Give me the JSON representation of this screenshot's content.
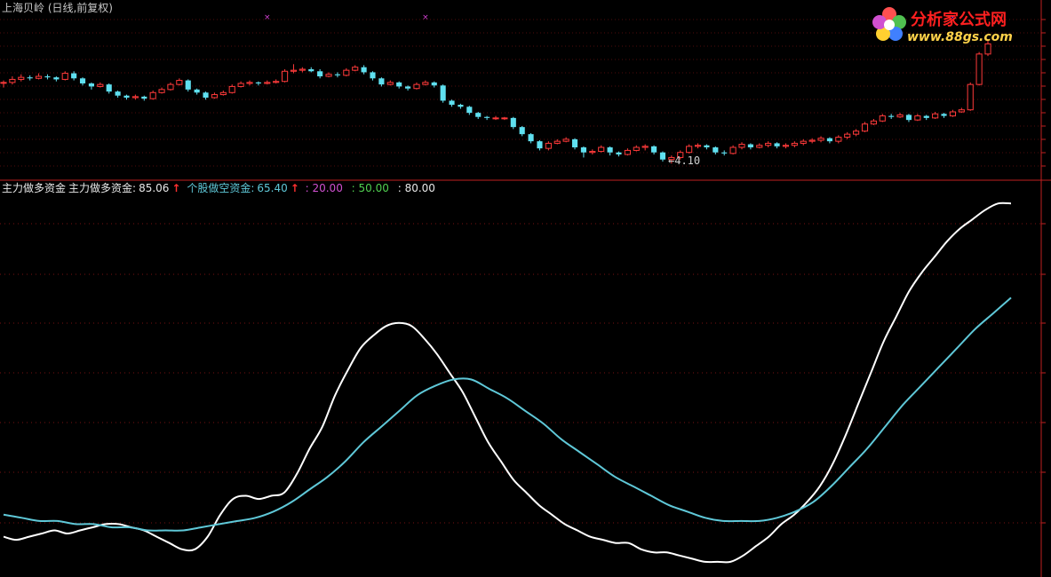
{
  "header": {
    "title": "上海贝岭 (日线,前复权)"
  },
  "logo": {
    "name": "分析家公式网",
    "url": "www.88gs.com"
  },
  "low_label": "←4.10",
  "indicator_legend": {
    "name1": "主力做多资金",
    "label_main": "主力做多资金:",
    "value_main": "85.06",
    "label_retail": "个股做空资金:",
    "value_retail": "65.40",
    "level_a": "20.00",
    "level_b": "50.00",
    "level_c": "80.00",
    "arrow": "↑"
  },
  "colors": {
    "background": "#000000",
    "up_candle": "#ff3a3a",
    "down_candle": "#5fe0f0",
    "grid": "#a01818",
    "white_line": "#ffffff",
    "cyan_line": "#5fc8d8"
  },
  "chart_data": [
    {
      "type": "candlestick",
      "ohlc": [
        [
          0.4,
          0.4,
          0.42,
          0.35
        ],
        [
          0.4,
          0.43,
          0.46,
          0.38
        ],
        [
          0.43,
          0.45,
          0.48,
          0.41
        ],
        [
          0.45,
          0.44,
          0.47,
          0.42
        ],
        [
          0.44,
          0.46,
          0.49,
          0.43
        ],
        [
          0.46,
          0.45,
          0.48,
          0.43
        ],
        [
          0.45,
          0.43,
          0.46,
          0.41
        ],
        [
          0.43,
          0.49,
          0.51,
          0.42
        ],
        [
          0.49,
          0.44,
          0.51,
          0.42
        ],
        [
          0.44,
          0.39,
          0.45,
          0.37
        ],
        [
          0.39,
          0.36,
          0.4,
          0.33
        ],
        [
          0.36,
          0.38,
          0.4,
          0.35
        ],
        [
          0.38,
          0.31,
          0.39,
          0.29
        ],
        [
          0.31,
          0.27,
          0.32,
          0.25
        ],
        [
          0.27,
          0.25,
          0.28,
          0.23
        ],
        [
          0.25,
          0.26,
          0.28,
          0.23
        ],
        [
          0.26,
          0.24,
          0.27,
          0.22
        ],
        [
          0.24,
          0.3,
          0.32,
          0.23
        ],
        [
          0.3,
          0.33,
          0.35,
          0.29
        ],
        [
          0.33,
          0.38,
          0.4,
          0.32
        ],
        [
          0.38,
          0.42,
          0.44,
          0.37
        ],
        [
          0.42,
          0.33,
          0.43,
          0.31
        ],
        [
          0.33,
          0.3,
          0.34,
          0.28
        ],
        [
          0.3,
          0.25,
          0.31,
          0.23
        ],
        [
          0.25,
          0.28,
          0.3,
          0.24
        ],
        [
          0.28,
          0.3,
          0.32,
          0.27
        ],
        [
          0.3,
          0.36,
          0.38,
          0.29
        ],
        [
          0.36,
          0.39,
          0.41,
          0.35
        ],
        [
          0.39,
          0.4,
          0.42,
          0.37
        ],
        [
          0.4,
          0.39,
          0.41,
          0.37
        ],
        [
          0.39,
          0.4,
          0.42,
          0.38
        ],
        [
          0.4,
          0.41,
          0.43,
          0.39
        ],
        [
          0.41,
          0.51,
          0.53,
          0.4
        ],
        [
          0.51,
          0.52,
          0.58,
          0.49
        ],
        [
          0.52,
          0.53,
          0.55,
          0.5
        ],
        [
          0.53,
          0.51,
          0.55,
          0.5
        ],
        [
          0.51,
          0.46,
          0.53,
          0.44
        ],
        [
          0.46,
          0.48,
          0.5,
          0.45
        ],
        [
          0.48,
          0.47,
          0.5,
          0.45
        ],
        [
          0.47,
          0.52,
          0.54,
          0.46
        ],
        [
          0.52,
          0.55,
          0.57,
          0.51
        ],
        [
          0.55,
          0.5,
          0.57,
          0.48
        ],
        [
          0.5,
          0.44,
          0.51,
          0.42
        ],
        [
          0.44,
          0.38,
          0.45,
          0.36
        ],
        [
          0.38,
          0.4,
          0.42,
          0.37
        ],
        [
          0.4,
          0.36,
          0.41,
          0.34
        ],
        [
          0.36,
          0.34,
          0.37,
          0.32
        ],
        [
          0.34,
          0.38,
          0.4,
          0.33
        ],
        [
          0.38,
          0.4,
          0.42,
          0.37
        ],
        [
          0.4,
          0.37,
          0.41,
          0.35
        ],
        [
          0.37,
          0.22,
          0.38,
          0.2
        ],
        [
          0.22,
          0.18,
          0.23,
          0.16
        ],
        [
          0.18,
          0.16,
          0.19,
          0.14
        ],
        [
          0.16,
          0.1,
          0.17,
          0.08
        ],
        [
          0.1,
          0.06,
          0.11,
          0.04
        ],
        [
          0.06,
          0.05,
          0.07,
          0.03
        ],
        [
          0.05,
          0.05,
          0.07,
          0.03
        ],
        [
          0.05,
          0.05,
          0.06,
          0.03
        ],
        [
          0.05,
          -0.04,
          0.06,
          -0.06
        ],
        [
          -0.04,
          -0.11,
          -0.03,
          -0.13
        ],
        [
          -0.11,
          -0.18,
          -0.1,
          -0.2
        ],
        [
          -0.18,
          -0.25,
          -0.17,
          -0.27
        ],
        [
          -0.25,
          -0.2,
          -0.18,
          -0.27
        ],
        [
          -0.2,
          -0.18,
          -0.16,
          -0.21
        ],
        [
          -0.18,
          -0.16,
          -0.14,
          -0.19
        ],
        [
          -0.16,
          -0.24,
          -0.15,
          -0.26
        ],
        [
          -0.24,
          -0.29,
          -0.23,
          -0.34
        ],
        [
          -0.29,
          -0.28,
          -0.26,
          -0.31
        ],
        [
          -0.28,
          -0.24,
          -0.22,
          -0.29
        ],
        [
          -0.24,
          -0.29,
          -0.23,
          -0.32
        ],
        [
          -0.29,
          -0.31,
          -0.28,
          -0.33
        ],
        [
          -0.31,
          -0.27,
          -0.25,
          -0.32
        ],
        [
          -0.27,
          -0.24,
          -0.22,
          -0.28
        ],
        [
          -0.24,
          -0.23,
          -0.21,
          -0.27
        ],
        [
          -0.23,
          -0.29,
          -0.22,
          -0.31
        ],
        [
          -0.29,
          -0.36,
          -0.28,
          -0.38
        ],
        [
          -0.36,
          -0.34,
          -0.32,
          -0.4
        ],
        [
          -0.34,
          -0.29,
          -0.27,
          -0.36
        ],
        [
          -0.29,
          -0.23,
          -0.21,
          -0.3
        ],
        [
          -0.23,
          -0.22,
          -0.2,
          -0.25
        ],
        [
          -0.22,
          -0.24,
          -0.21,
          -0.26
        ],
        [
          -0.24,
          -0.29,
          -0.23,
          -0.31
        ],
        [
          -0.29,
          -0.3,
          -0.27,
          -0.32
        ],
        [
          -0.3,
          -0.24,
          -0.22,
          -0.31
        ],
        [
          -0.24,
          -0.21,
          -0.19,
          -0.26
        ],
        [
          -0.21,
          -0.24,
          -0.2,
          -0.26
        ],
        [
          -0.24,
          -0.22,
          -0.2,
          -0.25
        ],
        [
          -0.22,
          -0.2,
          -0.18,
          -0.24
        ],
        [
          -0.2,
          -0.23,
          -0.19,
          -0.25
        ],
        [
          -0.23,
          -0.22,
          -0.2,
          -0.25
        ],
        [
          -0.22,
          -0.2,
          -0.18,
          -0.24
        ],
        [
          -0.2,
          -0.18,
          -0.16,
          -0.22
        ],
        [
          -0.18,
          -0.17,
          -0.15,
          -0.2
        ],
        [
          -0.17,
          -0.15,
          -0.13,
          -0.19
        ],
        [
          -0.15,
          -0.18,
          -0.14,
          -0.2
        ],
        [
          -0.18,
          -0.14,
          -0.12,
          -0.2
        ],
        [
          -0.14,
          -0.11,
          -0.09,
          -0.16
        ],
        [
          -0.11,
          -0.08,
          -0.06,
          -0.13
        ],
        [
          -0.08,
          -0.01,
          0.01,
          -0.09
        ],
        [
          -0.01,
          0.02,
          0.04,
          -0.02
        ],
        [
          0.02,
          0.07,
          0.09,
          0.01
        ],
        [
          0.07,
          0.06,
          0.09,
          0.04
        ],
        [
          0.06,
          0.08,
          0.1,
          0.05
        ],
        [
          0.08,
          0.03,
          0.09,
          0.01
        ],
        [
          0.03,
          0.07,
          0.09,
          0.02
        ],
        [
          0.07,
          0.05,
          0.08,
          0.03
        ],
        [
          0.05,
          0.09,
          0.11,
          0.04
        ],
        [
          0.09,
          0.07,
          0.1,
          0.05
        ],
        [
          0.07,
          0.11,
          0.13,
          0.06
        ],
        [
          0.11,
          0.13,
          0.15,
          0.1
        ],
        [
          0.13,
          0.38,
          0.4,
          0.12
        ],
        [
          0.38,
          0.68,
          0.7,
          0.37
        ],
        [
          0.68,
          0.78,
          0.82,
          0.66
        ]
      ],
      "price_min": -0.45,
      "price_max": 0.95,
      "signal_marks_x_index": [
        30,
        48,
        108,
        124,
        126,
        128,
        134
      ]
    },
    {
      "type": "line",
      "series": [
        {
          "name": "主力做多资金",
          "values": [
            10,
            9,
            10,
            11,
            12,
            11,
            12,
            13,
            14,
            14,
            13,
            12,
            10,
            8,
            6,
            6,
            10,
            17,
            22,
            23,
            22,
            23,
            24,
            30,
            38,
            45,
            55,
            63,
            70,
            74,
            77,
            78,
            77,
            73,
            68,
            62,
            56,
            48,
            40,
            34,
            28,
            24,
            20,
            17,
            14,
            12,
            10,
            9,
            8,
            8,
            6,
            5,
            5,
            4,
            3,
            2,
            2,
            2,
            4,
            7,
            10,
            14,
            17,
            21,
            26,
            33,
            42,
            52,
            62,
            72,
            80,
            88,
            94,
            99,
            104,
            108,
            111,
            114,
            116,
            116
          ]
        },
        {
          "name": "个股做空资金",
          "values": [
            17,
            16,
            15,
            15,
            14,
            14,
            13,
            13,
            12,
            12,
            12,
            13,
            14,
            15,
            16,
            18,
            21,
            25,
            29,
            34,
            40,
            45,
            50,
            55,
            58,
            60,
            60,
            57,
            54,
            50,
            46,
            41,
            37,
            33,
            29,
            26,
            23,
            20,
            18,
            16,
            15,
            15,
            15,
            16,
            18,
            21,
            26,
            32,
            38,
            45,
            52,
            58,
            64,
            70,
            76,
            81,
            86
          ]
        }
      ],
      "ylim": [
        0,
        120
      ]
    }
  ]
}
